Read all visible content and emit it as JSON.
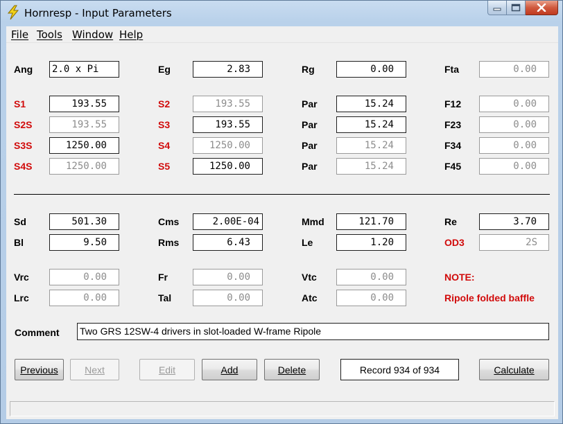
{
  "window": {
    "title": "Hornresp - Input Parameters",
    "accent_color": "#b9d1ea",
    "close_color": "#c7432a"
  },
  "menu": [
    "File",
    "Tools",
    "Window",
    "Help"
  ],
  "params": {
    "ang": {
      "label": "Ang",
      "value": "2.0 x Pi"
    },
    "eg": {
      "label": "Eg",
      "value": "2.83"
    },
    "rg": {
      "label": "Rg",
      "value": "0.00"
    },
    "fta": {
      "label": "Fta",
      "value": "0.00"
    },
    "s1": {
      "label": "S1",
      "value": "193.55"
    },
    "s2": {
      "label": "S2",
      "value": "193.55"
    },
    "par1": {
      "label": "Par",
      "value": "15.24"
    },
    "f12": {
      "label": "F12",
      "value": "0.00"
    },
    "s2s": {
      "label": "S2S",
      "value": "193.55"
    },
    "s3": {
      "label": "S3",
      "value": "193.55"
    },
    "par2": {
      "label": "Par",
      "value": "15.24"
    },
    "f23": {
      "label": "F23",
      "value": "0.00"
    },
    "s3s": {
      "label": "S3S",
      "value": "1250.00"
    },
    "s4": {
      "label": "S4",
      "value": "1250.00"
    },
    "par3": {
      "label": "Par",
      "value": "15.24"
    },
    "f34": {
      "label": "F34",
      "value": "0.00"
    },
    "s4s": {
      "label": "S4S",
      "value": "1250.00"
    },
    "s5": {
      "label": "S5",
      "value": "1250.00"
    },
    "par4": {
      "label": "Par",
      "value": "15.24"
    },
    "f45": {
      "label": "F45",
      "value": "0.00"
    },
    "sd": {
      "label": "Sd",
      "value": "501.30"
    },
    "cms": {
      "label": "Cms",
      "value": "2.00E-04"
    },
    "mmd": {
      "label": "Mmd",
      "value": "121.70"
    },
    "re": {
      "label": "Re",
      "value": "3.70"
    },
    "bl": {
      "label": "Bl",
      "value": "9.50"
    },
    "rms": {
      "label": "Rms",
      "value": "6.43"
    },
    "le": {
      "label": "Le",
      "value": "1.20"
    },
    "od3": {
      "label": "OD3",
      "value": "2S"
    },
    "vrc": {
      "label": "Vrc",
      "value": "0.00"
    },
    "fr": {
      "label": "Fr",
      "value": "0.00"
    },
    "vtc": {
      "label": "Vtc",
      "value": "0.00"
    },
    "lrc": {
      "label": "Lrc",
      "value": "0.00"
    },
    "tal": {
      "label": "Tal",
      "value": "0.00"
    },
    "atc": {
      "label": "Atc",
      "value": "0.00"
    }
  },
  "note": {
    "heading": "NOTE:",
    "text": "Ripole folded baffle"
  },
  "comment": {
    "label": "Comment",
    "value": "Two GRS 12SW-4 drivers in slot-loaded W-frame Ripole"
  },
  "buttons": {
    "previous": "Previous",
    "next": "Next",
    "edit": "Edit",
    "add": "Add",
    "delete": "Delete",
    "record": "Record 934 of 934",
    "calculate": "Calculate"
  },
  "colors": {
    "label_red": "#d10a0a",
    "disabled_text": "#8c8c8c",
    "client_bg": "#f0f0f0"
  }
}
